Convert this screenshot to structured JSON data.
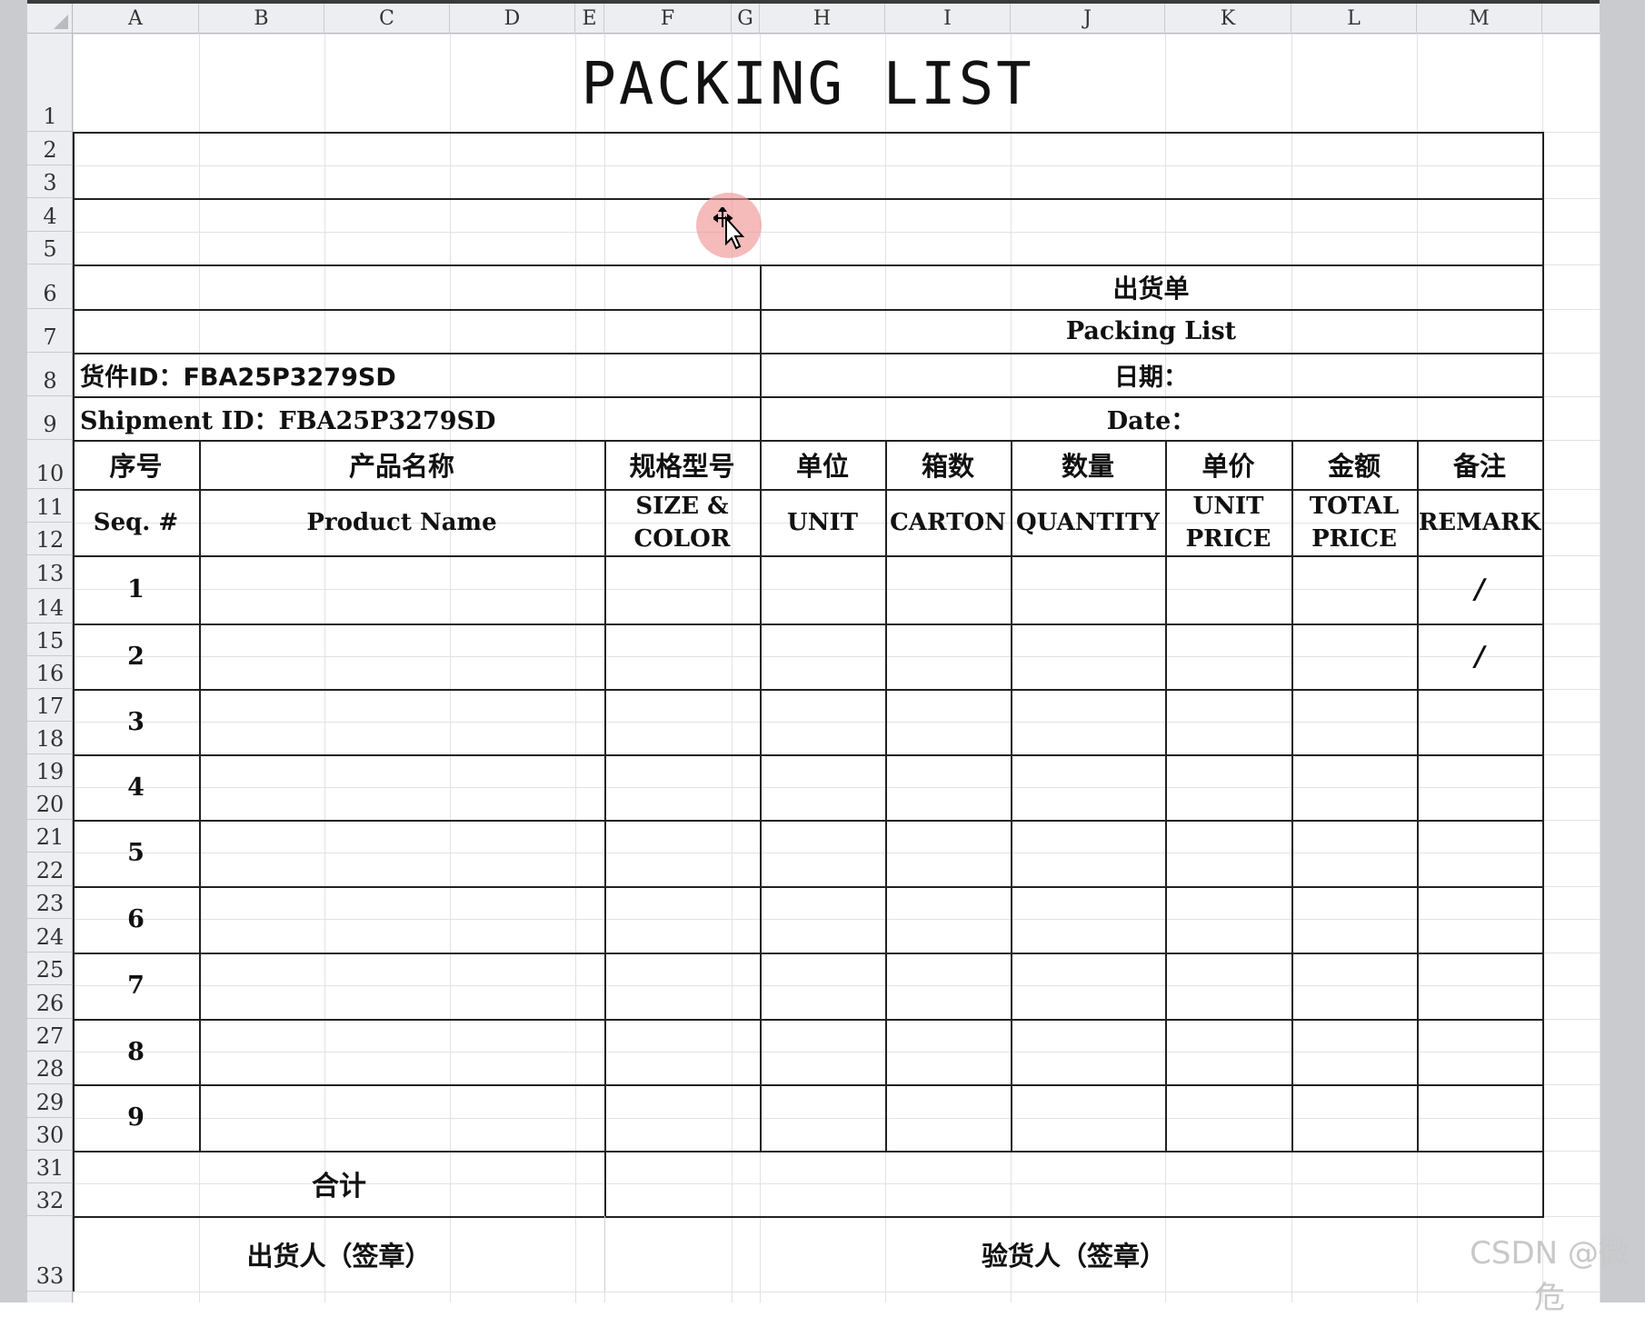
{
  "sheet": {
    "column_headers": [
      "A",
      "B",
      "C",
      "D",
      "E",
      "F",
      "G",
      "H",
      "I",
      "J",
      "K",
      "L",
      "M"
    ],
    "row_numbers": [
      "1",
      "2",
      "3",
      "4",
      "5",
      "6",
      "7",
      "8",
      "9",
      "10",
      "11",
      "12",
      "13",
      "14",
      "15",
      "16",
      "17",
      "18",
      "19",
      "20",
      "21",
      "22",
      "23",
      "24",
      "25",
      "26",
      "27",
      "28",
      "29",
      "30",
      "31",
      "32",
      "33"
    ]
  },
  "document": {
    "title": "PACKING LIST",
    "header_cn": "出货单",
    "header_en": "Packing List",
    "shipment_id_cn": "货件ID：FBA25P3279SD",
    "shipment_id_en": "Shipment ID：FBA25P3279SD",
    "date_cn": "日期：",
    "date_en": "Date："
  },
  "table": {
    "columns_cn": [
      "序号",
      "产品名称",
      "规格型号",
      "单位",
      "箱数",
      "数量",
      "单价",
      "金额",
      "备注"
    ],
    "columns_en": [
      "Seq. #",
      "Product Name",
      "SIZE &\nCOLOR",
      "UNIT",
      "CARTON",
      "QUANTITY",
      "UNIT\nPRICE",
      "TOTAL\nPRICE",
      "REMARK"
    ],
    "rows": [
      {
        "seq": "1",
        "remark": "/"
      },
      {
        "seq": "2",
        "remark": "/"
      },
      {
        "seq": "3",
        "remark": ""
      },
      {
        "seq": "4",
        "remark": ""
      },
      {
        "seq": "5",
        "remark": ""
      },
      {
        "seq": "6",
        "remark": ""
      },
      {
        "seq": "7",
        "remark": ""
      },
      {
        "seq": "8",
        "remark": ""
      },
      {
        "seq": "9",
        "remark": ""
      }
    ],
    "total_label": "合计"
  },
  "footer": {
    "shipper_sign": "出货人（签章）",
    "inspector_sign": "验货人（签章）"
  },
  "watermark": "CSDN @微危",
  "cursor": {
    "icon": "move-cursor-icon"
  }
}
